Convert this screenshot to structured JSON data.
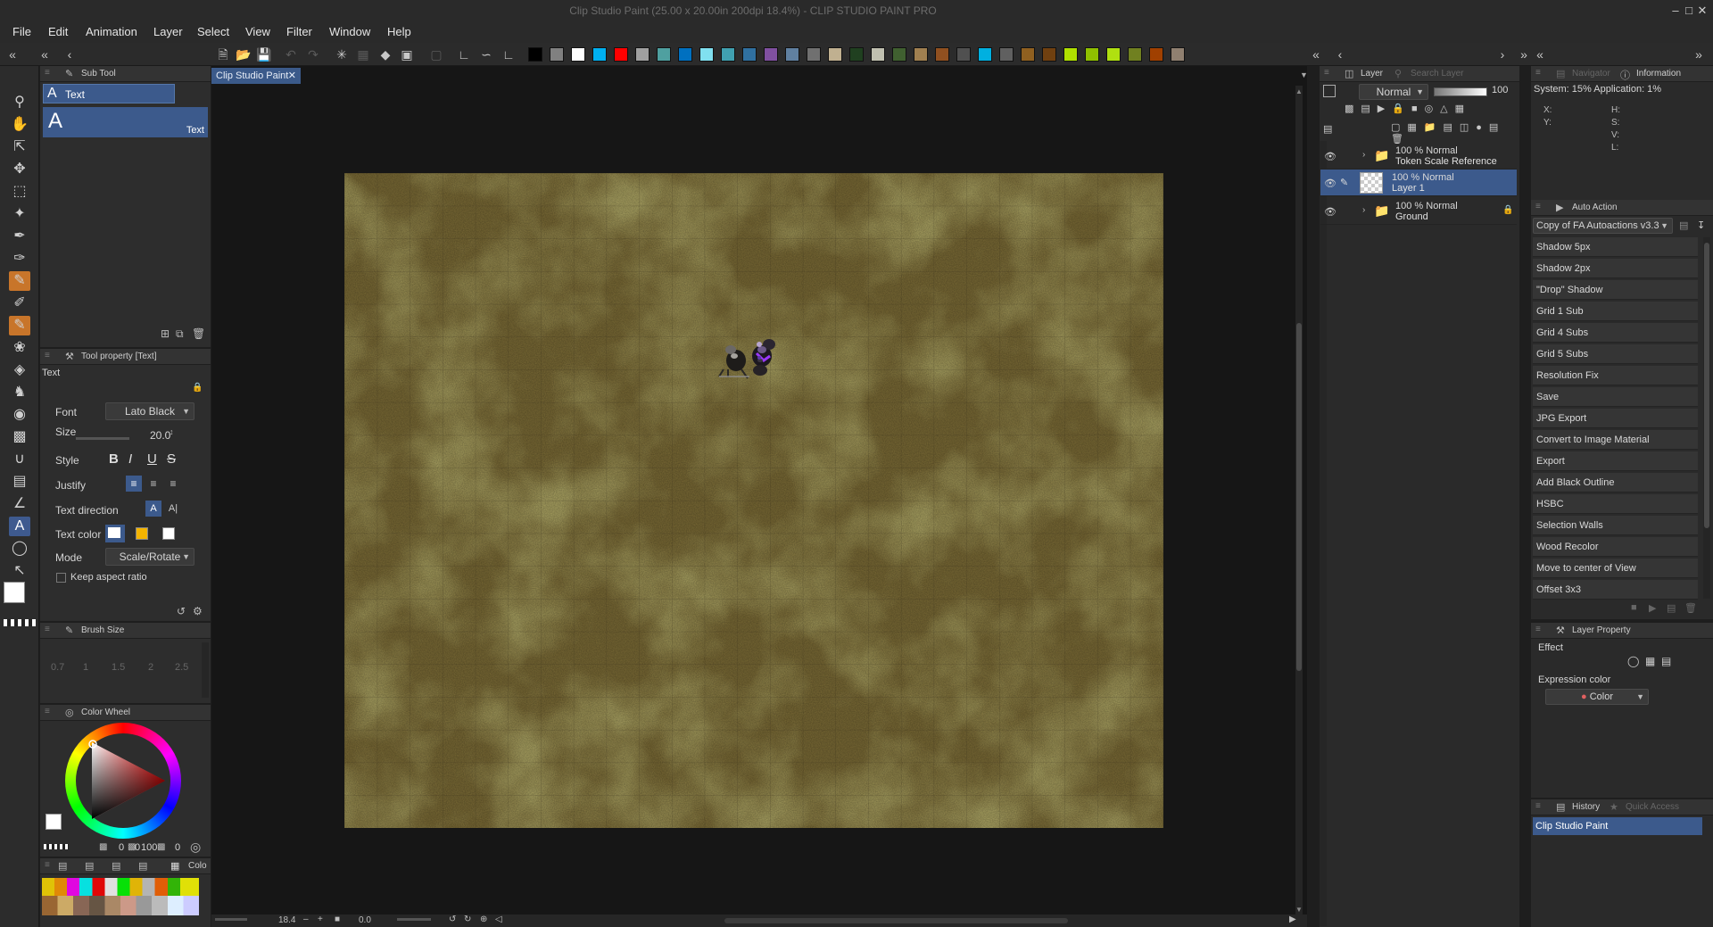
{
  "window": {
    "title": "Clip Studio Paint (25.00 x 20.00in 200dpi 18.4%)  - CLIP STUDIO PAINT PRO"
  },
  "menu": [
    "File",
    "Edit",
    "Animation",
    "Layer",
    "Select",
    "View",
    "Filter",
    "Window",
    "Help"
  ],
  "palette_colors": [
    "#000000",
    "#808080",
    "#ffffff",
    "#00b0f0",
    "#ff0000",
    "#a0a0a0",
    "#4fa0a0",
    "#0070c0",
    "#80e0f0",
    "#40a0b0",
    "#3070a0",
    "#8050a0",
    "#6080a0",
    "#707070",
    "#c0b090",
    "#204020",
    "#c0c0b0",
    "#406030",
    "#a08050",
    "#905020",
    "#505050",
    "#00b0e0",
    "#606060",
    "#906020",
    "#704010",
    "#b0e000",
    "#90c000",
    "#b0e010",
    "#708020",
    "#a04000",
    "#908070"
  ],
  "subtool": {
    "title": "Sub Tool",
    "group": "Text",
    "item": "Text"
  },
  "tool_property": {
    "title": "Tool property [Text]",
    "name": "Text",
    "font_label": "Font",
    "font_value": "Lato Black",
    "size_label": "Size",
    "size_value": "20.0",
    "style_label": "Style",
    "justify_label": "Justify",
    "text_direction_label": "Text direction",
    "text_color_label": "Text color",
    "mode_label": "Mode",
    "mode_value": "Scale/Rotate",
    "keep_aspect_label": "Keep aspect ratio"
  },
  "brush_size": {
    "title": "Brush Size",
    "values": [
      "0.7",
      "1",
      "1.5",
      "2",
      "2.5"
    ]
  },
  "color_wheel": {
    "title": "Color Wheel",
    "readout": [
      "0",
      "0",
      "100",
      "0"
    ]
  },
  "color_set_tab": "Colo",
  "document_tab": "Clip Studio Paint",
  "status": {
    "zoom": "18.4",
    "angle": "0.0"
  },
  "layer_panel": {
    "tab_layer": "Layer",
    "tab_search": "Search Layer",
    "blend_mode": "Normal",
    "opacity": "100",
    "layers": [
      {
        "opacity_mode": "100 % Normal",
        "name": "Token Scale Reference",
        "type": "folder",
        "selected": false,
        "locked": false
      },
      {
        "opacity_mode": "100 % Normal",
        "name": "Layer 1",
        "type": "raster",
        "selected": true,
        "locked": false
      },
      {
        "opacity_mode": "100 % Normal",
        "name": "Ground",
        "type": "folder",
        "selected": false,
        "locked": true
      }
    ]
  },
  "info_panel": {
    "tab_navigator": "Navigator",
    "tab_information": "Information",
    "system_text": "System: 15%  Application:  1%",
    "x_label": "X:",
    "y_label": "Y:",
    "h_label": "H:",
    "s_label": "S:",
    "v_label": "V:",
    "l_label": "L:"
  },
  "auto_action": {
    "title": "Auto Action",
    "set_name": "Copy of FA Autoactions v3.3",
    "items": [
      "Shadow 5px",
      "Shadow 2px",
      "\"Drop\" Shadow",
      "Grid 1 Sub",
      "Grid 4 Subs",
      "Grid 5 Subs",
      "Resolution Fix",
      "Save",
      "JPG Export",
      "Convert to Image Material",
      "Export",
      "Add Black Outline",
      "HSBC",
      "Selection Walls",
      "Wood Recolor",
      "Move to center of View",
      "Offset 3x3"
    ]
  },
  "layer_property": {
    "title": "Layer Property",
    "effect_label": "Effect",
    "expression_label": "Expression color",
    "expression_value": "Color"
  },
  "history": {
    "tab_history": "History",
    "tab_quick": "Quick Access",
    "items": [
      "Clip Studio Paint"
    ]
  }
}
